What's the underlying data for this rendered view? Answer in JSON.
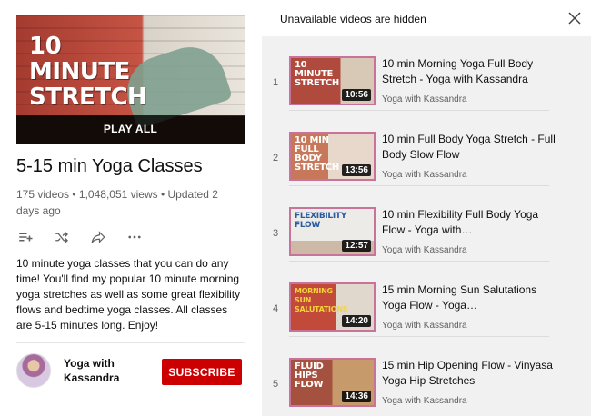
{
  "playlist": {
    "thumbnail_text": "10 MINUTE STRETCH",
    "play_all_label": "PLAY ALL",
    "title": "5-15 min Yoga Classes",
    "meta": "175 videos • 1,048,051 views • Updated 2 days ago",
    "description": "10 minute yoga classes that you can do any time! You'll find my popular 10 minute morning yoga stretches as well as some great flexibility flows and bedtime yoga classes. All classes are 5-15 minutes long. Enjoy!",
    "actions": [
      "add-to-queue-icon",
      "shuffle-icon",
      "share-icon",
      "more-icon"
    ]
  },
  "owner": {
    "name": "Yoga with Kassandra",
    "subscribe_label": "SUBSCRIBE"
  },
  "header": {
    "notice": "Unavailable videos are hidden"
  },
  "videos": [
    {
      "index": "1",
      "thumb_text": "10 MINUTE STRETCH",
      "duration": "10:56",
      "title": "10 min Morning Yoga Full Body Stretch - Yoga with Kassandra",
      "channel": "Yoga with Kassandra",
      "text_color": "#ffffff",
      "bg": "#b04a3c"
    },
    {
      "index": "2",
      "thumb_text": "10 MIN FULL BODY STRETCH",
      "duration": "13:56",
      "title": "10 min Full Body Yoga Stretch - Full Body Slow Flow",
      "channel": "Yoga with Kassandra",
      "text_color": "#ffffff",
      "bg": "#c8785a"
    },
    {
      "index": "3",
      "thumb_text": "FLEXIBILITY FLOW",
      "duration": "12:57",
      "title": "10 min Flexibility Full Body Yoga Flow - Yoga with…",
      "channel": "Yoga with Kassandra",
      "text_color": "#2a5aa0",
      "bg": "#e8e6e2"
    },
    {
      "index": "4",
      "thumb_text": "MORNING SUN SALUTATIONS",
      "duration": "14:20",
      "title": "15 min Morning Sun Salutations Yoga Flow - Yoga…",
      "channel": "Yoga with Kassandra",
      "text_color": "#f7d23a",
      "bg": "#c24a3a"
    },
    {
      "index": "5",
      "thumb_text": "FLUID HIPS FLOW",
      "duration": "14:36",
      "title": "15 min Hip Opening Flow - Vinyasa Yoga Hip Stretches",
      "channel": "Yoga with Kassandra",
      "text_color": "#ffffff",
      "bg": "#a5513f"
    }
  ]
}
